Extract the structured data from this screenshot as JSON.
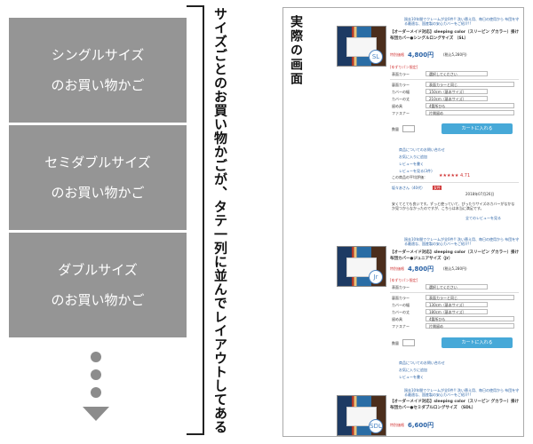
{
  "left_blocks": [
    {
      "line1": "シングルサイズ",
      "line2": "のお買い物かご"
    },
    {
      "line1": "セミダブルサイズ",
      "line2": "のお買い物かご"
    },
    {
      "line1": "ダブルサイズ",
      "line2": "のお買い物かご"
    }
  ],
  "caption": "サイズごとのお買い物かごが、タテ一列に並んでレイアウトしてある",
  "panel": {
    "title": "実際の画面",
    "products": [
      {
        "intro": "過去10年間でクレームが全0件!! 洗い替え用、毎日の使用から 布団を守る最適な、国産製の安心カバーをご紹介!!",
        "name": "【オーダーメイド対応】sleeping color（スリーピン グカラー）掛け布団カバー●シングルロングサイズ （SL）",
        "price_label": "特別価格",
        "price": "4,800円",
        "tax": "(税込5,280円)",
        "badge": "SL",
        "option_note": "[ゆずりパン限定]",
        "option_labels": [
          "表面カラー",
          "裏面カラー",
          "カバーの幅",
          "カバーの丈",
          "留め具",
          "ファスナー"
        ],
        "option_values": [
          "選択してください",
          "表面カラーと同じ",
          "150cm（基本サイズ）",
          "210cm（基本サイズ）",
          "4箇所ひも",
          "片側留め"
        ],
        "qty_label": "数量",
        "cart_label": "カートに入れる",
        "links": [
          "商品についてのお問い合わせ",
          "お気に入りに追加",
          "レビューを書く",
          "レビューを見る(3件)"
        ],
        "rating_label": "この商品の平均評価：",
        "rating": "★★★★★ 4.71",
        "review_user": "坂々あさん（40代）",
        "review_tag": "女性",
        "review_date": "2018年07月26日",
        "review_text": "安くてとても良いです。ずっと使っていて、ぴったりサイズのカバーがなかなか見つからなかったのですが、こちらは本当に満足です。",
        "more_reviews": "全てのレビューを見る"
      },
      {
        "intro": "過去10年間でクレームが全0件!! 洗い替え用、毎日の使用から 布団を守る最適な、国産製の安心カバーをご紹介!!",
        "name": "【オーダーメイド対応】sleeping color（スリーピン グカラー）掛け布団カバー●ジュニアサイズ（Jr）",
        "price_label": "特別価格",
        "price": "4,800円",
        "tax": "(税込5,280円)",
        "badge": "Jr",
        "option_note": "[ゆずりパン限定]",
        "option_labels": [
          "表面カラー",
          "裏面カラー",
          "カバーの幅",
          "カバーの丈",
          "留め具",
          "ファスナー"
        ],
        "option_values": [
          "選択してください",
          "表面カラーと同じ",
          "130cm（基本サイズ）",
          "180cm（基本サイズ）",
          "4箇所ひも",
          "片側留め"
        ],
        "qty_label": "数量",
        "cart_label": "カートに入れる",
        "links": [
          "商品についてのお問い合わせ",
          "お気に入りに追加",
          "レビューを書く"
        ]
      },
      {
        "intro": "過去10年間でクレームが全0件!! 洗い替え用、毎日の使用から 布団を守る最適な、国産製の安心カバーをご紹介!!",
        "name": "【オーダーメイド対応】sleeping color（スリーピン グカラー）掛け布団カバー●セミダブルロングサイズ （SDL）",
        "price_label": "特別価格",
        "price": "6,600円",
        "badge": "SDL"
      }
    ]
  },
  "colors": {
    "block_gray": "#959595",
    "accent_blue": "#47a9d8",
    "link_blue": "#2b63a6",
    "red": "#d03333"
  }
}
